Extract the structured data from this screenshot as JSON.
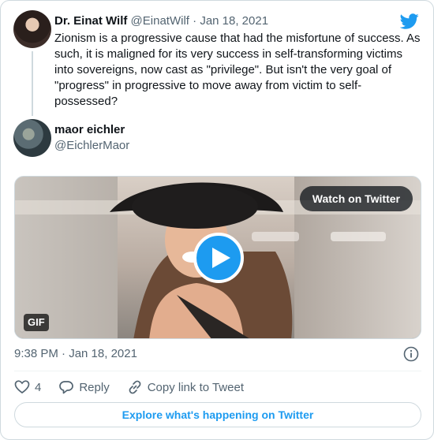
{
  "quoted_tweet": {
    "name": "Dr. Einat Wilf",
    "handle": "@EinatWilf",
    "separator": "·",
    "date": "Jan 18, 2021",
    "text": "Zionism is a progressive cause that had the misfortune of success. As such, it is maligned for its very success in self-transforming victims into sovereigns, now cast as \"privilege\". But isn't the very goal of \"progress\" in progressive to move away from victim to self-possessed?"
  },
  "tweet": {
    "name": "maor eichler",
    "handle": "@EichlerMaor",
    "media": {
      "watch_label": "Watch on Twitter",
      "badge": "GIF"
    },
    "timestamp": "9:38 PM · Jan 18, 2021",
    "actions": {
      "like_count": "4",
      "reply_label": "Reply",
      "copy_label": "Copy link to Tweet"
    },
    "explore_label": "Explore what's happening on Twitter"
  },
  "colors": {
    "accent": "#1d9bf0",
    "text": "#0f1419",
    "muted": "#536471",
    "border": "#cfd9de"
  },
  "icons": [
    "twitter-bird-icon",
    "play-icon",
    "info-icon",
    "heart-icon",
    "reply-icon",
    "link-icon"
  ]
}
